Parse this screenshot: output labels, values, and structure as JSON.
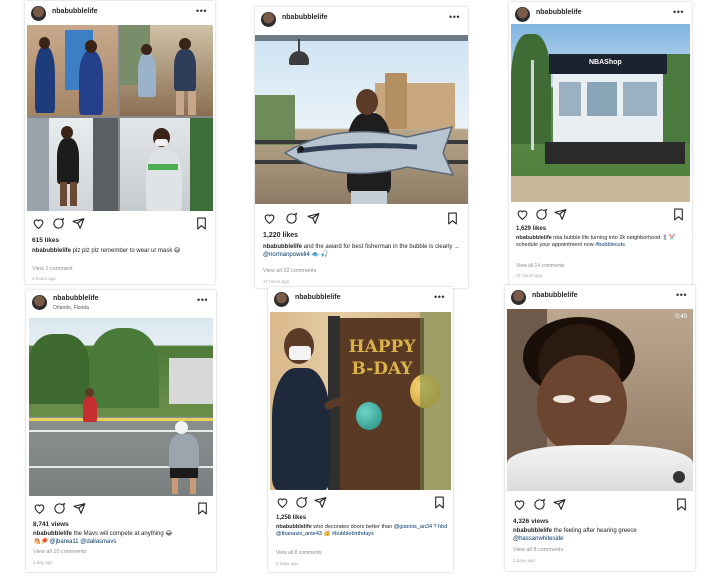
{
  "posts": [
    {
      "username": "nbabubblelife",
      "likes": "615 likes",
      "caption_user": "nbabubblelife",
      "caption_text": "plz plz plz remember to wear ur mask",
      "caption_emoji": "😷",
      "comments": "View 1 comment",
      "time": "2 hours ago"
    },
    {
      "username": "nbabubblelife",
      "likes": "1,220 likes",
      "caption_user": "nbabubblelife",
      "caption_text": "and the award for best fisherman in the bubble is clearly ... ",
      "caption_mention": "@normanpowell4",
      "caption_emoji": "🐟 🎣",
      "comments": "View all 22 comments",
      "time": "17 hours ago"
    },
    {
      "username": "nbabubblelife",
      "likes": "1,629 likes",
      "caption_user": "nbabubblelife",
      "caption_text": "nba bubble life turning into 2k neighborhood 💈✂️ schedule your appointment now",
      "caption_tag": "#bubblecuts",
      "comments": "View all 14 comments",
      "time": "21 hours ago",
      "sign": "NBAShop"
    },
    {
      "username": "nbabubblelife",
      "location": "Orlando, Florida",
      "likes": "8,741 views",
      "caption_user": "nbabubblelife",
      "caption_text": "the Mavs will compete at anything 😂",
      "caption_line2": "🐴🏓 ",
      "caption_mention": "@jbarea11 @dallasmavs",
      "comments": "View all 10 comments",
      "time": "1 day ago"
    },
    {
      "username": "nbabubblelife",
      "likes": "1,258 likes",
      "caption_user": "nbabubblelife",
      "caption_text": "who decorates doors better than",
      "caption_mention": "@giannis_an34 ? hbd @thanasis_ante43",
      "caption_emoji": "🥳",
      "caption_tag": "#bubblebirthdays",
      "comments": "View all 8 comments",
      "time": "2 days ago",
      "balloon_text": "HAPPY B-DAY"
    },
    {
      "username": "nbabubblelife",
      "likes": "4,326 views",
      "caption_user": "nbabubblelife",
      "caption_text": "the feeling after hearing greece",
      "caption_mention": "@hassanwhiteside",
      "comments": "View all 8 comments",
      "time": "2 days ago",
      "timer": "0:40"
    }
  ],
  "icons": [
    "heart-icon",
    "comment-icon",
    "share-icon",
    "bookmark-icon",
    "more-icon"
  ],
  "colors": {
    "text": "#262626",
    "muted": "#8e8e8e",
    "link": "#00376b"
  }
}
